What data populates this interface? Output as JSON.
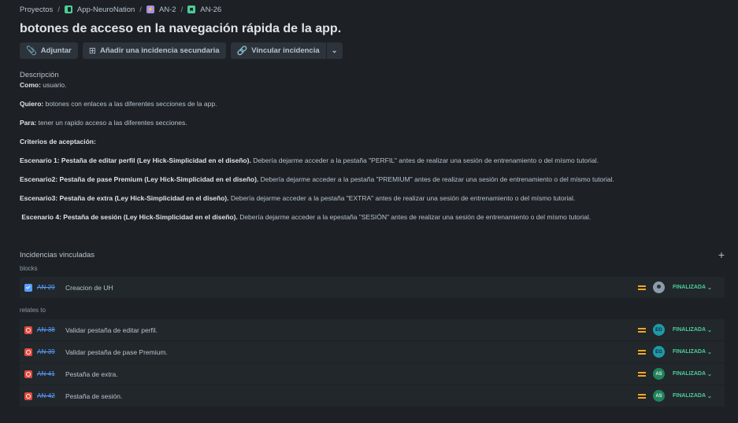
{
  "breadcrumb": {
    "root": "Proyectos",
    "project": "App-NeuroNation",
    "epic": "AN-2",
    "issue": "AN-26",
    "separator": "/"
  },
  "title": "botones de acceso en la navegación rápida de la app.",
  "toolbar": {
    "attach": "Adjuntar",
    "add_child": "Añadir una incidencia secundaria",
    "link": "Vincular incidencia",
    "more": "⌄"
  },
  "description": {
    "label": "Descripción",
    "como_label": "Como:",
    "como_text": " usuario.",
    "quiero_label": "Quiero:",
    "quiero_text": " botones con enlaces a las diferentes secciones de la app.",
    "para_label": "Para:",
    "para_text": " tener un rapido acceso a las diferentes secciones.",
    "criterios": "Criterios de aceptación:",
    "esc1_label": "Escenario 1: Pestaña de editar perfil (Ley Hick-Simplicidad en el diseño).",
    "esc1_text": " Debería dejarme acceder a la pestaña \"PERFIL\" antes de realizar una sesión de entrenamiento o del mísmo tutorial.",
    "esc2_label": "Escenario2: Pestaña de pase Premium (Ley Hick-Simplicidad en el diseño).",
    "esc2_text": " Debería dejarme acceder a la pestaña \"PREMIUM\" antes de realizar una sesión de entrenamiento o del mísmo tutorial.",
    "esc3_label": "Escenario3: Pestaña de extra (Ley Hick-Simplicidad en el diseño).",
    "esc3_text": " Debería dejarme acceder a la pestaña \"EXTRA\" antes de realizar una sesión de entrenamiento o del mísmo tutorial.",
    "esc4_label": " Escenario 4: Pestaña de sesión (Ley Hick-Simplicidad en el diseño).",
    "esc4_text": " Debería dejarme acceder a la epestaña \"SESIÓN\" antes de realizar una sesión de entrenamiento o del mísmo tutorial."
  },
  "linked": {
    "title": "Incidencias vinculadas",
    "add": "+",
    "blocks_label": "blocks",
    "relates_label": "relates to",
    "blocks": [
      {
        "key": "AN-29",
        "summary": "Creacion de UH",
        "type": "task",
        "priority": "medium",
        "assignee": "",
        "status": "FINALIZADA"
      }
    ],
    "relates": [
      {
        "key": "AN-38",
        "summary": "Validar pestaña de editar perfil.",
        "type": "bug",
        "priority": "medium",
        "assignee": "EG",
        "status": "FINALIZADA"
      },
      {
        "key": "AN-39",
        "summary": "Validar pestaña de pase Premium.",
        "type": "bug",
        "priority": "medium",
        "assignee": "EG",
        "status": "FINALIZADA"
      },
      {
        "key": "AN-41",
        "summary": "Pestaña de extra.",
        "type": "bug",
        "priority": "medium",
        "assignee": "AS",
        "status": "FINALIZADA"
      },
      {
        "key": "AN-42",
        "summary": "Pestaña de sesión.",
        "type": "bug",
        "priority": "medium",
        "assignee": "AS",
        "status": "FINALIZADA"
      }
    ]
  },
  "colors": {
    "background": "#1d2125",
    "status_done": "#4bce97",
    "priority_medium": "#f5a623",
    "link": "#579dff"
  }
}
